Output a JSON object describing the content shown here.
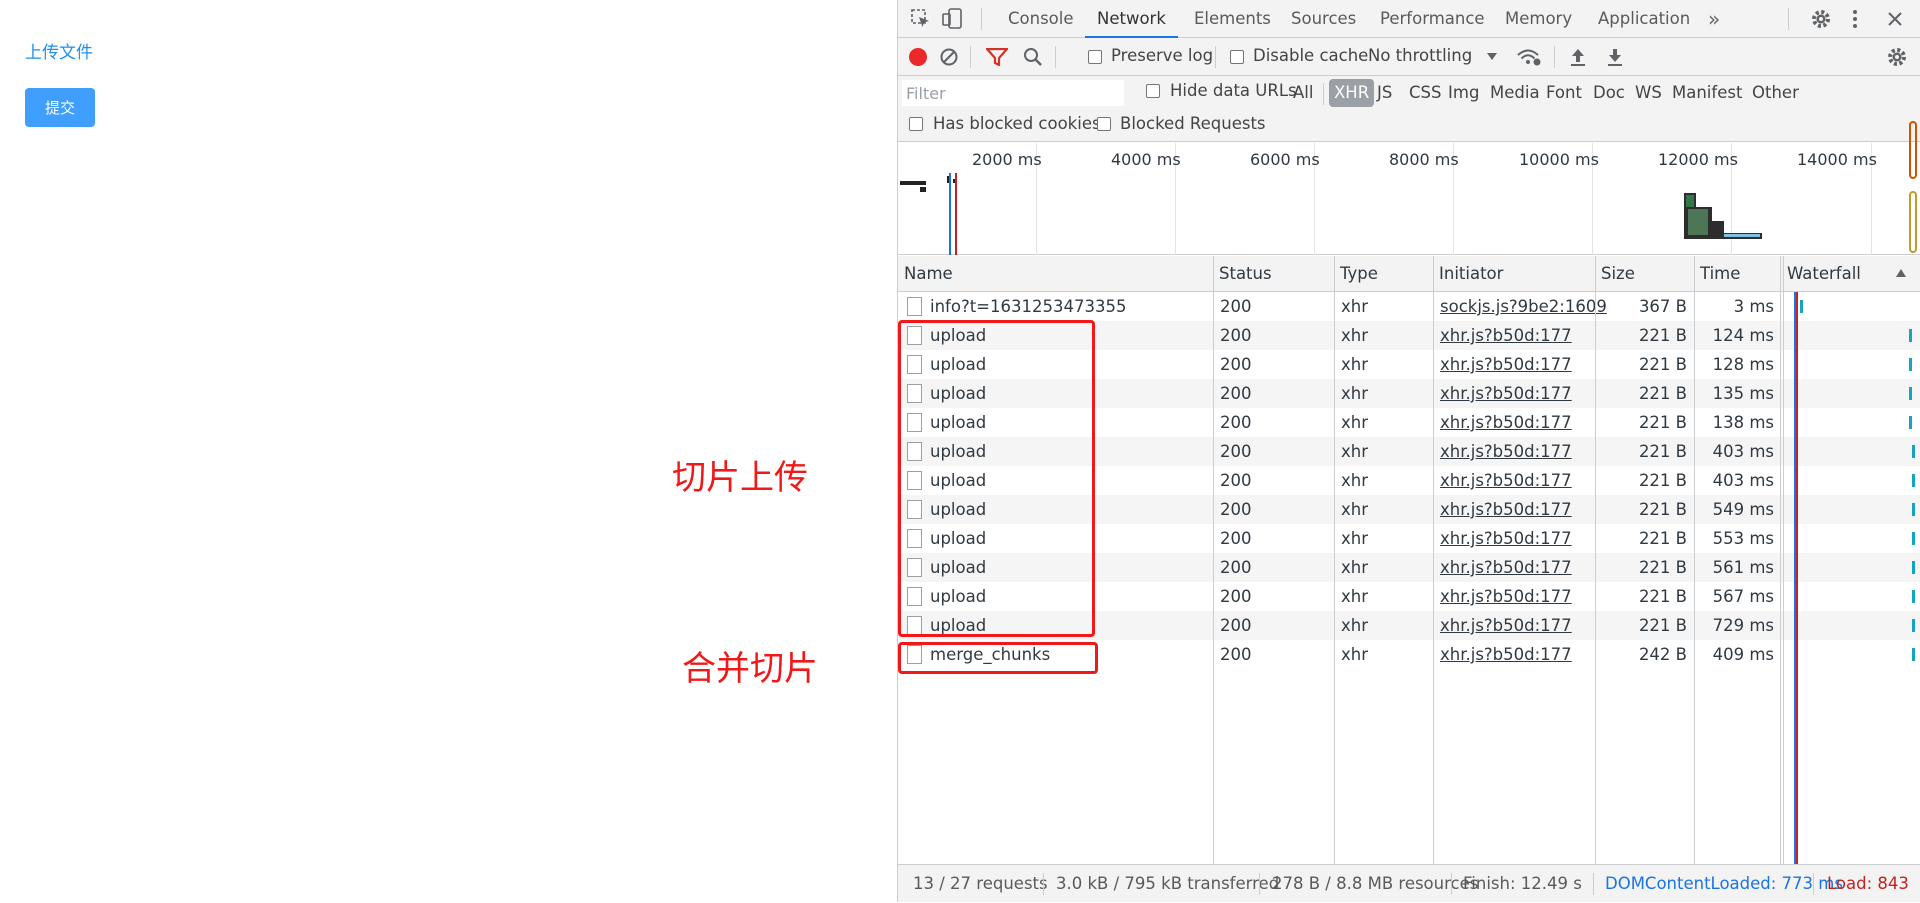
{
  "app": {
    "upload_link": "上传文件",
    "submit_label": "提交",
    "annotation_slice": "切片上传",
    "annotation_merge": "合并切片"
  },
  "devtools": {
    "tabs": [
      "Console",
      "Network",
      "Elements",
      "Sources",
      "Performance",
      "Memory",
      "Application"
    ],
    "active_tab": "Network",
    "toolbar": {
      "preserve_log": "Preserve log",
      "disable_cache": "Disable cache",
      "throttling": "No throttling"
    },
    "filter": {
      "placeholder": "Filter",
      "hide_data_urls": "Hide data URLs",
      "types": [
        "All",
        "XHR",
        "JS",
        "CSS",
        "Img",
        "Media",
        "Font",
        "Doc",
        "WS",
        "Manifest",
        "Other"
      ],
      "active_type": "XHR",
      "has_blocked_cookies": "Has blocked cookies",
      "blocked_requests": "Blocked Requests"
    },
    "overview_ticks": [
      "2000 ms",
      "4000 ms",
      "6000 ms",
      "8000 ms",
      "10000 ms",
      "12000 ms",
      "14000 ms"
    ],
    "columns": [
      "Name",
      "Status",
      "Type",
      "Initiator",
      "Size",
      "Time",
      "Waterfall"
    ],
    "rows": [
      {
        "name": "info?t=1631253473355",
        "status": "200",
        "type": "xhr",
        "initiator": "sockjs.js?9be2:1609",
        "size": "367 B",
        "time": "3 ms"
      },
      {
        "name": "upload",
        "status": "200",
        "type": "xhr",
        "initiator": "xhr.js?b50d:177",
        "size": "221 B",
        "time": "124 ms"
      },
      {
        "name": "upload",
        "status": "200",
        "type": "xhr",
        "initiator": "xhr.js?b50d:177",
        "size": "221 B",
        "time": "128 ms"
      },
      {
        "name": "upload",
        "status": "200",
        "type": "xhr",
        "initiator": "xhr.js?b50d:177",
        "size": "221 B",
        "time": "135 ms"
      },
      {
        "name": "upload",
        "status": "200",
        "type": "xhr",
        "initiator": "xhr.js?b50d:177",
        "size": "221 B",
        "time": "138 ms"
      },
      {
        "name": "upload",
        "status": "200",
        "type": "xhr",
        "initiator": "xhr.js?b50d:177",
        "size": "221 B",
        "time": "403 ms"
      },
      {
        "name": "upload",
        "status": "200",
        "type": "xhr",
        "initiator": "xhr.js?b50d:177",
        "size": "221 B",
        "time": "403 ms"
      },
      {
        "name": "upload",
        "status": "200",
        "type": "xhr",
        "initiator": "xhr.js?b50d:177",
        "size": "221 B",
        "time": "549 ms"
      },
      {
        "name": "upload",
        "status": "200",
        "type": "xhr",
        "initiator": "xhr.js?b50d:177",
        "size": "221 B",
        "time": "553 ms"
      },
      {
        "name": "upload",
        "status": "200",
        "type": "xhr",
        "initiator": "xhr.js?b50d:177",
        "size": "221 B",
        "time": "561 ms"
      },
      {
        "name": "upload",
        "status": "200",
        "type": "xhr",
        "initiator": "xhr.js?b50d:177",
        "size": "221 B",
        "time": "567 ms"
      },
      {
        "name": "upload",
        "status": "200",
        "type": "xhr",
        "initiator": "xhr.js?b50d:177",
        "size": "221 B",
        "time": "729 ms"
      },
      {
        "name": "merge_chunks",
        "status": "200",
        "type": "xhr",
        "initiator": "xhr.js?b50d:177",
        "size": "242 B",
        "time": "409 ms"
      }
    ],
    "status": {
      "requests": "13 / 27 requests",
      "transferred": "3.0 kB / 795 kB transferred",
      "resources": "278 B / 8.8 MB resources",
      "finish": "Finish: 12.49 s",
      "dom_content_loaded": "DOMContentLoaded: 773 ms",
      "load": "Load: 843"
    },
    "colors": {
      "accent": "#1a73e8",
      "record": "#ea2a2a",
      "annotation": "#f01818",
      "dcl": "#1a73e8",
      "load": "#c5221f"
    }
  }
}
